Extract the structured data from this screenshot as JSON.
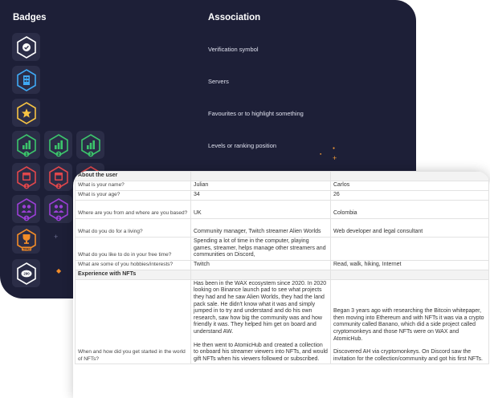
{
  "header": {
    "badges_title": "Badges",
    "association_title": "Association"
  },
  "associations": [
    "Verification symbol",
    "Servers",
    "Favourites or to highlight something",
    "Levels or ranking position"
  ],
  "badges": [
    {
      "icon": "verified-check-icon",
      "color": "#ffffff"
    },
    {
      "icon": "server-icon",
      "color": "#3fa9f5"
    },
    {
      "icon": "star-icon",
      "color": "#f6c343"
    },
    {
      "icon": "level-1-icon",
      "color": "#3cc46c",
      "number": "1"
    },
    {
      "icon": "level-2-icon",
      "color": "#3cc46c",
      "number": "2"
    },
    {
      "icon": "level-3-icon",
      "color": "#3cc46c",
      "number": "3"
    },
    {
      "icon": "calendar-level-1-icon",
      "color": "#e0474c",
      "number": "1"
    },
    {
      "icon": "calendar-level-2-icon",
      "color": "#e0474c",
      "number": "2"
    },
    {
      "icon": "calendar-level-3-icon",
      "color": "#e0474c"
    },
    {
      "icon": "people-level-1-icon",
      "color": "#9b3fd6",
      "number": "1"
    },
    {
      "icon": "people-level-2-icon",
      "color": "#9b3fd6",
      "number": "2"
    },
    {
      "icon": "trophy-icon",
      "color": "#f28c28",
      "label": "TRAD"
    },
    {
      "icon": "chat-count-icon",
      "color": "#ffffff",
      "label": "290"
    }
  ],
  "accents": {
    "panel": "#1d1f37",
    "tile": "#2b2d47",
    "spark": "#f29a38"
  },
  "table": {
    "section_about": "About the user",
    "rows": [
      {
        "q": "What is your name?",
        "a1": "Julian",
        "a2": "Carlos"
      },
      {
        "q": "What is your age?",
        "a1": "34",
        "a2": "26"
      },
      {
        "q": "Where are you from and where are you based?",
        "a1": "UK",
        "a2": "Colombia"
      },
      {
        "q": "What do you do for a living?",
        "a1": "Community manager, Twitch streamer Alien Worlds",
        "a2": "Web developer and legal consultant"
      },
      {
        "q": "What do you like to do in your free time?",
        "a1": "Spending a lot of time in the computer, playing games, streamer, helps manage other streamers and communities on Discord,",
        "a2": ""
      },
      {
        "q": "What are some of you hobbies/interests?",
        "a1": "Twitch",
        "a2": "Read, walk, hiking, Internet"
      }
    ],
    "section_experience": "Experience with NFTs",
    "nft_question": "When and how did you get started in the world of NFTs?",
    "nft_a1_p1": "Has been in the WAX ecosystem since 2020. In 2020 looking on Binance launch pad to see what projects they had and he saw Alien Worlds, they had the land pack sale. He didn't know what it was and simply jumped in to try and understand and do his own research, saw how big the community was and how friendly it was. They helped him get on board and understand AW.",
    "nft_a1_p2": "He then went to AtomicHub and created a collection to onboard his streamer viewers into NFTs, and would gift NFTs when his viewers followed or subscribed.",
    "nft_a2_p1": "Began 3 years ago with researching the  Bitcoin whitepaper, then moving into Ethereum and with NFTs it was via a crypto community called Banano, which did a side project called cryptomonkeys and those NFTs were on WAX and AtomicHub.",
    "nft_a2_p2": "Discovered AH via cryptomonkeys. On Discord saw the invitation for the collection/community and got his first NFTs."
  }
}
